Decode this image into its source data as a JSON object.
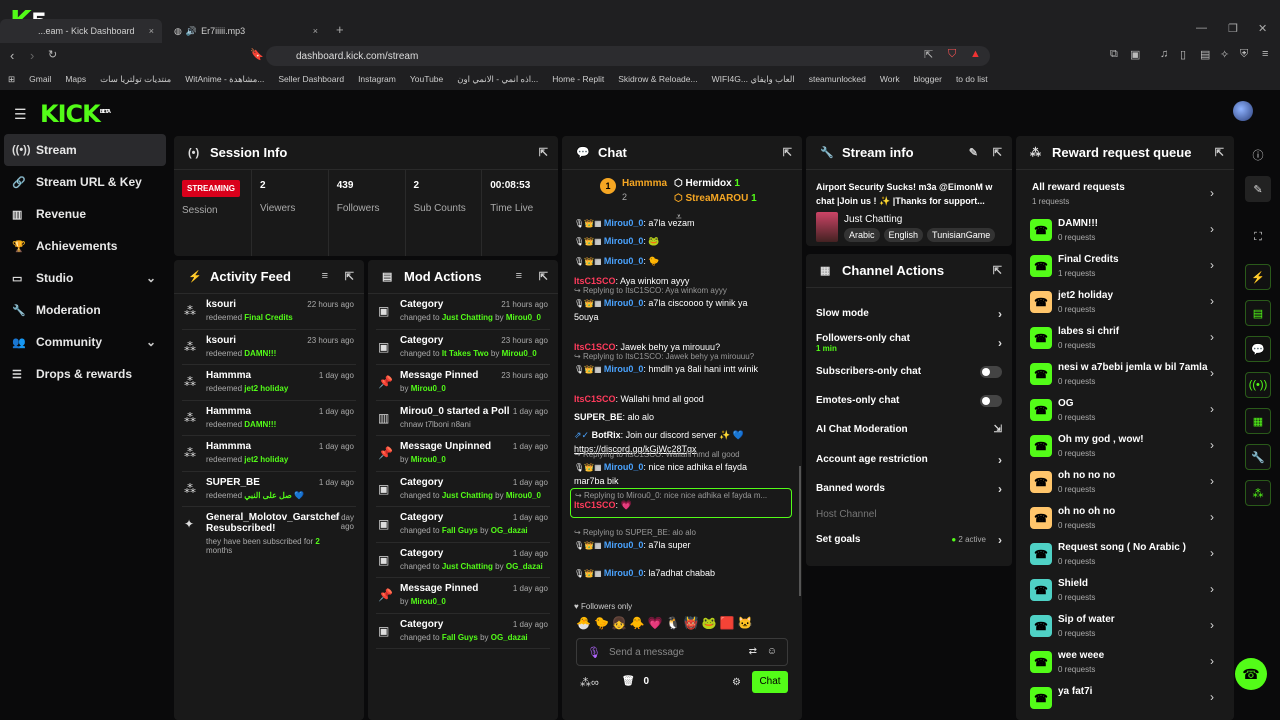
{
  "browser": {
    "tabs": [
      {
        "label": "...eam - Kick Dashboard",
        "close": "×"
      },
      {
        "label": "Er7iiiii.mp3",
        "close": "×"
      }
    ],
    "new_tab": "+",
    "url": "dashboard.kick.com/stream",
    "bookmarks": [
      "Gmail",
      "Maps",
      "منتديات تولتريا سات",
      "WitAnime - مشاهدة...",
      "Seller Dashboard",
      "Instagram",
      "YouTube",
      "اذه انمي - الانمي اون...",
      "Home - Replit",
      "Skidrow & Reloade...",
      "WIFI4G... العاب وايفاي",
      "steamunlocked",
      "Work",
      "blogger",
      "to do list"
    ],
    "overlay_logo": "K",
    "overlay_number": "5"
  },
  "app": {
    "logo": "KICK",
    "logo_sup": "BETA",
    "sidebar": [
      {
        "label": "Stream",
        "icon": "stream-icon",
        "selected": true
      },
      {
        "label": "Stream URL & Key",
        "icon": "link-icon"
      },
      {
        "label": "Revenue",
        "icon": "chart-icon"
      },
      {
        "label": "Achievements",
        "icon": "trophy-icon"
      },
      {
        "label": "Studio",
        "icon": "studio-icon",
        "chevron": "⌄"
      },
      {
        "label": "Moderation",
        "icon": "wrench-icon"
      },
      {
        "label": "Community",
        "icon": "community-icon",
        "chevron": "⌄"
      },
      {
        "label": "Drops & rewards",
        "icon": "drops-icon"
      }
    ],
    "session": {
      "title": "Session Info",
      "status": "STREAMING",
      "status_label": "Session",
      "stats": [
        {
          "v": "2",
          "l": "Viewers"
        },
        {
          "v": "439",
          "l": "Followers"
        },
        {
          "v": "2",
          "l": "Sub Counts"
        },
        {
          "v": "00:08:53",
          "l": "Time Live"
        }
      ]
    },
    "activity": {
      "title": "Activity Feed",
      "items": [
        {
          "name": "ksouri",
          "verb": "redeemed",
          "item": "Final Credits",
          "time": "22 hours ago"
        },
        {
          "name": "ksouri",
          "verb": "redeemed",
          "item": "DAMN!!!",
          "time": "23 hours ago"
        },
        {
          "name": "Hammma",
          "verb": "redeemed",
          "item": "jet2 holiday",
          "time": "1 day ago"
        },
        {
          "name": "Hammma",
          "verb": "redeemed",
          "item": "DAMN!!!",
          "time": "1 day ago"
        },
        {
          "name": "Hammma",
          "verb": "redeemed",
          "item": "jet2 holiday",
          "time": "1 day ago"
        },
        {
          "name": "SUPER_BE",
          "verb": "redeemed",
          "item": "صل على النبي 💙",
          "time": "1 day ago"
        }
      ],
      "resub": {
        "name": "General_Molotov_Garstchef",
        "name2": "Resubscribed!",
        "text": "they have been subscribed for",
        "months": "2",
        "months_label": "months",
        "time": "1 day ago"
      }
    },
    "mod": {
      "title": "Mod Actions",
      "items": [
        {
          "title": "Category",
          "line": "changed to",
          "val": "Just Chatting",
          "by": "Mirou0_0",
          "time": "21 hours ago"
        },
        {
          "title": "Category",
          "line": "changed to",
          "val": "It Takes Two",
          "by": "Mirou0_0",
          "time": "23 hours ago"
        },
        {
          "title": "Message Pinned",
          "line": "by",
          "val": "",
          "by": "Mirou0_0",
          "time": "23 hours ago"
        },
        {
          "title": "Mirou0_0 started a Poll",
          "line": "chnaw t7lboni n8ani",
          "val": "",
          "by": "",
          "time": "1 day ago"
        },
        {
          "title": "Message Unpinned",
          "line": "by",
          "val": "",
          "by": "Mirou0_0",
          "time": "1 day ago"
        },
        {
          "title": "Category",
          "line": "changed to",
          "val": "Just Chatting",
          "by": "Mirou0_0",
          "time": "1 day ago"
        },
        {
          "title": "Category",
          "line": "changed to",
          "val": "Fall Guys",
          "by": "OG_dazai",
          "time": "1 day ago"
        },
        {
          "title": "Category",
          "line": "changed to",
          "val": "Just Chatting",
          "by": "OG_dazai",
          "time": "1 day ago"
        },
        {
          "title": "Message Pinned",
          "line": "by",
          "val": "",
          "by": "Mirou0_0",
          "time": "1 day ago"
        },
        {
          "title": "Category",
          "line": "changed to",
          "val": "Fall Guys",
          "by": "OG_dazai",
          "time": "1 day ago"
        }
      ]
    },
    "chat": {
      "title": "Chat",
      "top": [
        {
          "rank": "1",
          "name": "Hammma",
          "n": "2"
        },
        {
          "name": "Hermidox",
          "n": "1"
        },
        {
          "name": "StreaMAROU",
          "n": "1"
        }
      ],
      "messages": [
        {
          "user": "Mirou0_0",
          "text": ": a7la vezam"
        },
        {
          "user": "Mirou0_0",
          "text": ": 🐸"
        },
        {
          "user": "Mirou0_0",
          "text": ": 🐤"
        },
        {
          "user": "ItsC1SCO",
          "text": ": Aya winkom ayyy"
        },
        {
          "reply": "Replying to ItsC1SCO: Aya winkom ayyy",
          "user": "Mirou0_0",
          "text": ": a7la ciscoooo ty winik ya",
          "text2": "5ouya"
        },
        {
          "user": "ItsC1SCO",
          "text": ": Jawek behy ya mirouuu?"
        },
        {
          "reply": "Replying to ItsC1SCO: Jawek behy ya mirouuu?",
          "user": "Mirou0_0",
          "text": ": hmdlh ya 8ali hani intt winik"
        },
        {
          "user": "ItsC1SCO",
          "text": ": Wallahi hmd all good"
        },
        {
          "user": "SUPER_BE",
          "text": ": alo alo"
        },
        {
          "user": "BotRix",
          "text": ": Join our discord server ✨ 💙",
          "text2": "https://discord.gg/kGjWc28Tgx"
        },
        {
          "reply": "Replying to ItsC1SCO: Wallahi hmd all good",
          "user": "Mirou0_0",
          "text": ": nice nice adhika el fayda",
          "text2": "mar7ba bik"
        },
        {
          "reply": "Replying to Mirou0_0: nice nice adhika el fayda m...",
          "user": "ItsC1SCO",
          "text": ": 💗"
        },
        {
          "reply": "Replying to SUPER_BE: alo alo",
          "user": "Mirou0_0",
          "text": ": a7la super"
        },
        {
          "user": "Mirou0_0",
          "text": ": la7adhat chabab"
        }
      ],
      "followers_only": "Followers only",
      "placeholder": "Send a message",
      "count": "0",
      "send": "Chat"
    },
    "stream_info": {
      "title": "Stream info",
      "stream_title": "Airport Security Sucks! m3a @EimonM w chat |Join us ! ✨ |Thanks for support...",
      "category": "Just Chatting",
      "tags": [
        "Arabic",
        "English",
        "TunisianGame"
      ]
    },
    "channel_actions": {
      "title": "Channel Actions",
      "rows": [
        {
          "label": "Slow mode",
          "type": "arrow"
        },
        {
          "label": "Followers-only chat",
          "sub": "1 min",
          "type": "arrow"
        },
        {
          "label": "Subscribers-only chat",
          "type": "toggle"
        },
        {
          "label": "Emotes-only chat",
          "type": "toggle"
        },
        {
          "label": "AI Chat Moderation",
          "type": "ext"
        },
        {
          "label": "Account age restriction",
          "type": "arrow"
        },
        {
          "label": "Banned words",
          "type": "arrow"
        },
        {
          "label": "Host Channel",
          "type": "none"
        },
        {
          "label": "Set goals",
          "type": "arrow",
          "badge": "2 active"
        }
      ]
    },
    "rewards": {
      "title": "Reward request queue",
      "all": {
        "name": "All reward requests",
        "count": "1 requests"
      },
      "items": [
        {
          "name": "DAMN!!!",
          "count": "0 requests",
          "color": "#53fc18"
        },
        {
          "name": "Final Credits",
          "count": "1 requests",
          "color": "#53fc18"
        },
        {
          "name": "jet2 holiday",
          "count": "0 requests",
          "color": "#ffc56b"
        },
        {
          "name": "labes si chrif",
          "count": "0 requests",
          "color": "#53fc18"
        },
        {
          "name": "nesi w a7bebi jemla w bil 7amla",
          "count": "0 requests",
          "color": "#53fc18"
        },
        {
          "name": "OG",
          "count": "0 requests",
          "color": "#53fc18"
        },
        {
          "name": "Oh my god , wow!",
          "count": "0 requests",
          "color": "#53fc18"
        },
        {
          "name": "oh no no no",
          "count": "0 requests",
          "color": "#ffc56b"
        },
        {
          "name": "oh no oh no",
          "count": "0 requests",
          "color": "#ffc56b"
        },
        {
          "name": "Request song ( No Arabic )",
          "count": "0 requests",
          "color": "#4fd1c5"
        },
        {
          "name": "Shield",
          "count": "0 requests",
          "color": "#4fd1c5"
        },
        {
          "name": "Sip of water",
          "count": "0 requests",
          "color": "#4fd1c5"
        },
        {
          "name": "wee weee",
          "count": "0 requests",
          "color": "#53fc18"
        },
        {
          "name": "ya fat7i",
          "count": "",
          "color": "#53fc18"
        }
      ]
    }
  }
}
